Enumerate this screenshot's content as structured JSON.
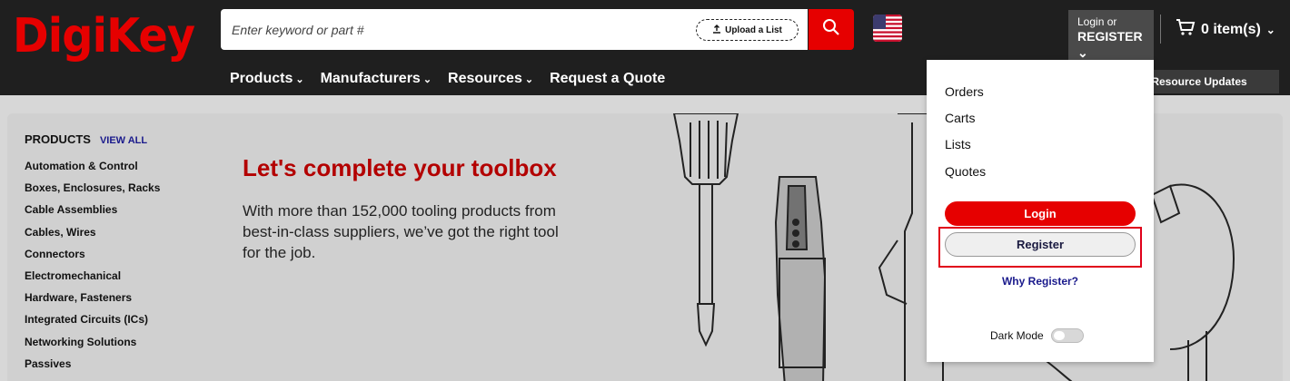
{
  "brand": {
    "logo_text": "DigiKey",
    "accent_color": "#e60000"
  },
  "search": {
    "placeholder": "Enter keyword or part #",
    "value": "",
    "upload_label": "Upload a List",
    "search_icon": "search-icon"
  },
  "header": {
    "flag_icon": "us-flag-icon",
    "login_small": "Login or",
    "login_big": "REGISTER",
    "cart_label": "0 item(s)",
    "cart_icon": "cart-icon"
  },
  "nav": {
    "items": [
      {
        "label": "Products",
        "has_dropdown": true
      },
      {
        "label": "Manufacturers",
        "has_dropdown": true
      },
      {
        "label": "Resources",
        "has_dropdown": true
      },
      {
        "label": "Request a Quote",
        "has_dropdown": false
      }
    ],
    "resource_bar": "f Resource Updates"
  },
  "sidebar": {
    "title": "PRODUCTS",
    "view_all": "VIEW ALL",
    "items": [
      "Automation & Control",
      "Boxes, Enclosures, Racks",
      "Cable Assemblies",
      "Cables, Wires",
      "Connectors",
      "Electromechanical",
      "Hardware, Fasteners",
      "Integrated Circuits (ICs)",
      "Networking Solutions",
      "Passives"
    ]
  },
  "hero": {
    "title": "Let's complete your toolbox",
    "body": "With more than 152,000 tooling products from best-in-class suppliers, we’ve got the right tool for the job."
  },
  "dropdown": {
    "links": [
      "Orders",
      "Carts",
      "Lists",
      "Quotes"
    ],
    "login_button": "Login",
    "register_button": "Register",
    "why_register": "Why Register?",
    "dark_mode_label": "Dark Mode",
    "dark_mode_on": false
  }
}
